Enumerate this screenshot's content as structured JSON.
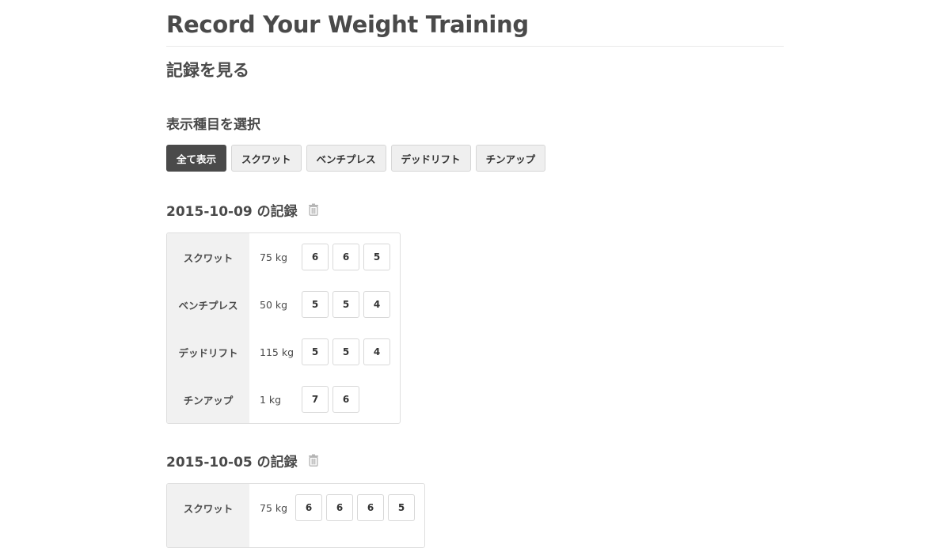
{
  "app": {
    "title": "Record Your Weight Training"
  },
  "page": {
    "heading": "記録を見る",
    "filter_heading": "表示種目を選択"
  },
  "filters": [
    {
      "label": "全て表示",
      "active": true
    },
    {
      "label": "スクワット",
      "active": false
    },
    {
      "label": "ベンチプレス",
      "active": false
    },
    {
      "label": "デッドリフト",
      "active": false
    },
    {
      "label": "チンアップ",
      "active": false
    }
  ],
  "icons": {
    "delete": "trash-icon"
  },
  "colors": {
    "active_button": "#4a4a4a",
    "text": "#4a4a4a",
    "label_column_bg": "#f1f1f1"
  },
  "records": [
    {
      "heading": "2015-10-09 の記録",
      "exercises": [
        {
          "name": "スクワット",
          "weight": "75 kg",
          "reps": [
            "6",
            "6",
            "5"
          ]
        },
        {
          "name": "ベンチプレス",
          "weight": "50 kg",
          "reps": [
            "5",
            "5",
            "4"
          ]
        },
        {
          "name": "デッドリフト",
          "weight": "115 kg",
          "reps": [
            "5",
            "5",
            "4"
          ]
        },
        {
          "name": "チンアップ",
          "weight": "1 kg",
          "reps": [
            "7",
            "6"
          ]
        }
      ]
    },
    {
      "heading": "2015-10-05 の記録",
      "exercises": [
        {
          "name": "スクワット",
          "weight": "75 kg",
          "reps": [
            "6",
            "6",
            "6",
            "5"
          ]
        }
      ]
    }
  ]
}
